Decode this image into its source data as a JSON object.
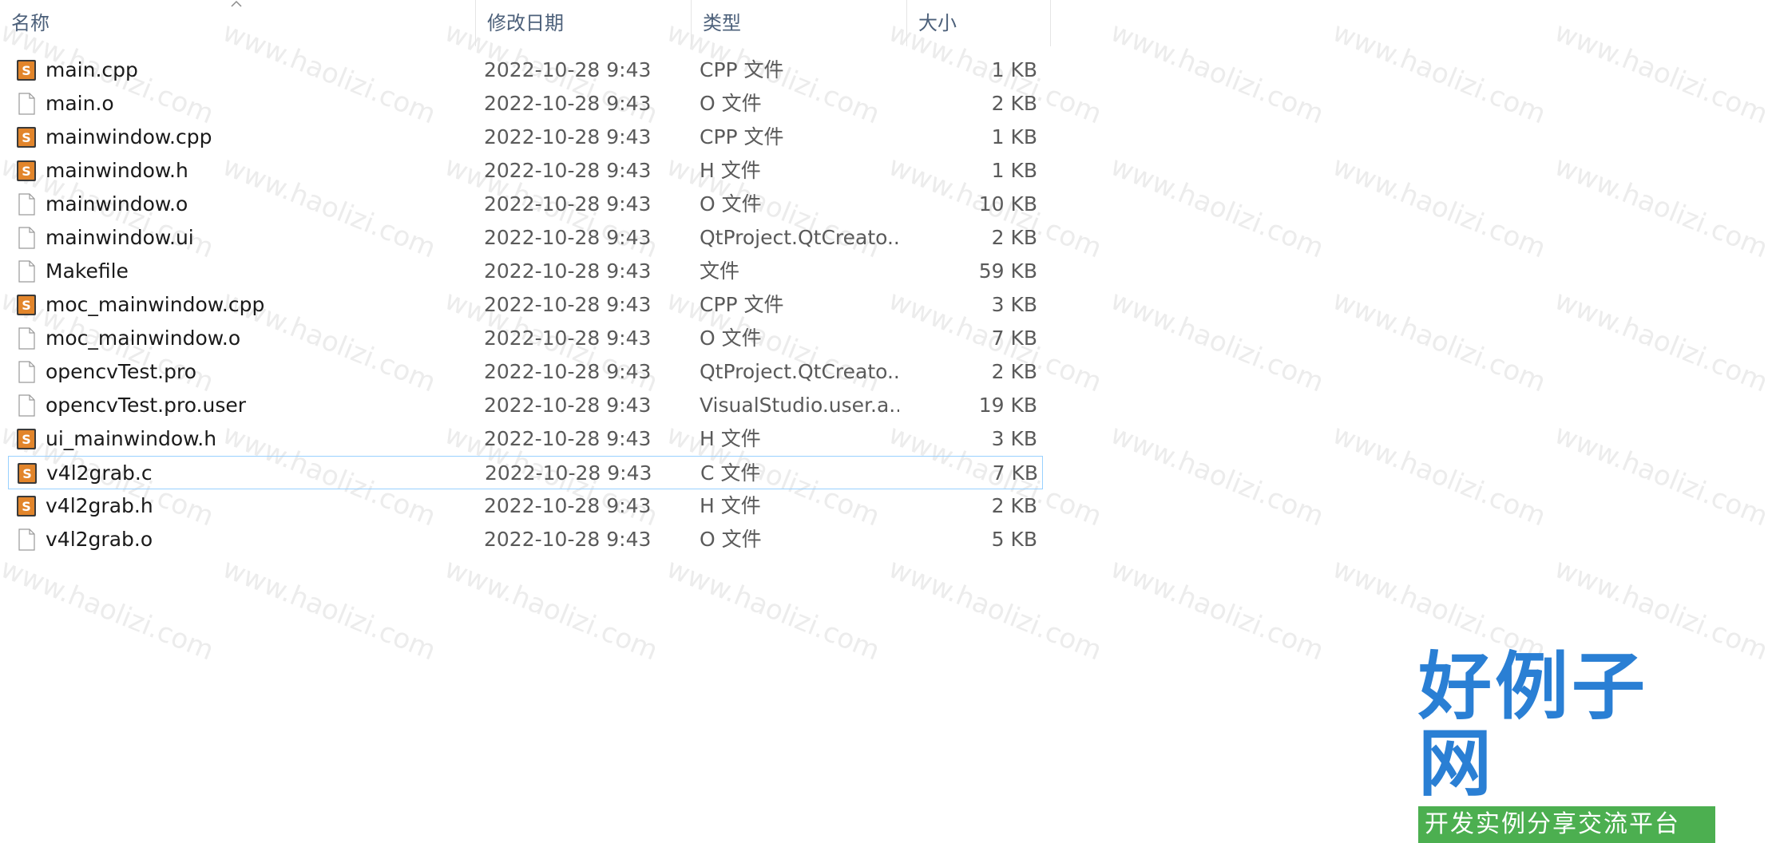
{
  "columns": {
    "name": "名称",
    "date": "修改日期",
    "type": "类型",
    "size": "大小"
  },
  "files": [
    {
      "name": "main.cpp",
      "date": "2022-10-28 9:43",
      "type": "CPP 文件",
      "size": "1 KB",
      "icon": "sublime-file-icon"
    },
    {
      "name": "main.o",
      "date": "2022-10-28 9:43",
      "type": "O 文件",
      "size": "2 KB",
      "icon": "blank-file-icon"
    },
    {
      "name": "mainwindow.cpp",
      "date": "2022-10-28 9:43",
      "type": "CPP 文件",
      "size": "1 KB",
      "icon": "sublime-file-icon"
    },
    {
      "name": "mainwindow.h",
      "date": "2022-10-28 9:43",
      "type": "H 文件",
      "size": "1 KB",
      "icon": "sublime-file-icon"
    },
    {
      "name": "mainwindow.o",
      "date": "2022-10-28 9:43",
      "type": "O 文件",
      "size": "10 KB",
      "icon": "blank-file-icon"
    },
    {
      "name": "mainwindow.ui",
      "date": "2022-10-28 9:43",
      "type": "QtProject.QtCreato...",
      "size": "2 KB",
      "icon": "blank-file-icon"
    },
    {
      "name": "Makefile",
      "date": "2022-10-28 9:43",
      "type": "文件",
      "size": "59 KB",
      "icon": "blank-file-icon"
    },
    {
      "name": "moc_mainwindow.cpp",
      "date": "2022-10-28 9:43",
      "type": "CPP 文件",
      "size": "3 KB",
      "icon": "sublime-file-icon"
    },
    {
      "name": "moc_mainwindow.o",
      "date": "2022-10-28 9:43",
      "type": "O 文件",
      "size": "7 KB",
      "icon": "blank-file-icon"
    },
    {
      "name": "opencvTest.pro",
      "date": "2022-10-28 9:43",
      "type": "QtProject.QtCreato...",
      "size": "2 KB",
      "icon": "blank-file-icon"
    },
    {
      "name": "opencvTest.pro.user",
      "date": "2022-10-28 9:43",
      "type": "VisualStudio.user.a...",
      "size": "19 KB",
      "icon": "blank-file-icon"
    },
    {
      "name": "ui_mainwindow.h",
      "date": "2022-10-28 9:43",
      "type": "H 文件",
      "size": "3 KB",
      "icon": "sublime-file-icon"
    },
    {
      "name": "v4l2grab.c",
      "date": "2022-10-28 9:43",
      "type": "C 文件",
      "size": "7 KB",
      "icon": "sublime-file-icon",
      "selected": true
    },
    {
      "name": "v4l2grab.h",
      "date": "2022-10-28 9:43",
      "type": "H 文件",
      "size": "2 KB",
      "icon": "sublime-file-icon"
    },
    {
      "name": "v4l2grab.o",
      "date": "2022-10-28 9:43",
      "type": "O 文件",
      "size": "5 KB",
      "icon": "blank-file-icon"
    }
  ],
  "watermark": {
    "text": "www.haolizi.com"
  },
  "brand": {
    "title": "好例子网",
    "subtitle": "开发实例分享交流平台"
  },
  "colors": {
    "header_text": "#4c607a",
    "selection_border": "#99d1ff",
    "sublime_icon": "#e2852b",
    "brand_blue": "#2a7fd4",
    "brand_green": "#4caf50"
  }
}
